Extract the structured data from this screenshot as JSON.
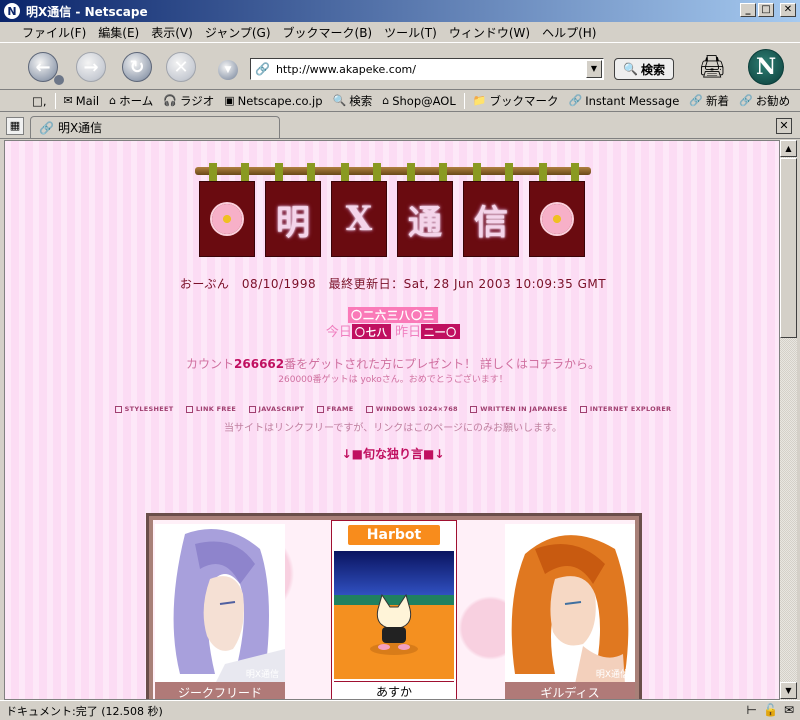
{
  "window": {
    "title": "明X通信 - Netscape",
    "icon": "netscape-n-icon"
  },
  "menu": [
    "ファイル(F)",
    "編集(E)",
    "表示(V)",
    "ジャンプ(G)",
    "ブックマーク(B)",
    "ツール(T)",
    "ウィンドウ(W)",
    "ヘルプ(H)"
  ],
  "toolbar": {
    "url": "http://www.akapeke.com/",
    "search_label": "検索"
  },
  "personal_bar": [
    {
      "label": "Mail",
      "icon": "mail-icon"
    },
    {
      "label": "ホーム",
      "icon": "home-icon"
    },
    {
      "label": "ラジオ",
      "icon": "headphones-icon"
    },
    {
      "label": "Netscape.co.jp",
      "icon": "my-icon"
    },
    {
      "label": "検索",
      "icon": "search-icon"
    },
    {
      "label": "Shop@AOL",
      "icon": "shop-icon"
    },
    {
      "label": "ブックマーク",
      "icon": "folder-icon"
    },
    {
      "label": "Instant Message",
      "icon": "link-icon"
    },
    {
      "label": "新着",
      "icon": "link-icon"
    },
    {
      "label": "お勧め",
      "icon": "link-icon"
    }
  ],
  "tab": {
    "label": "明X通信"
  },
  "page": {
    "banner_chars": [
      "明",
      "X",
      "通",
      "信"
    ],
    "since_line": "おーぷん　08/10/1998　最終更新日：Sat, 28 Jun 2003 10:09:35 GMT",
    "total_count": "〇二六三八〇三",
    "today_label": "今日",
    "today_count": "〇七八",
    "yesterday_label": "昨日",
    "yesterday_count": "二一〇",
    "kiriban_pre": "カウント",
    "kiriban_num": "266662",
    "kiriban_post": "番をゲットされた方にプレゼント！ 詳しくはコチラから。",
    "thanks": "260000番ゲットは yokoさん。おめでとうございます！",
    "env": [
      "STYLESHEET",
      "LINK FREE",
      "JAVASCRIPT",
      "FRAME",
      "WINDOWS 1024×768",
      "WRITTEN IN JAPANESE",
      "INTERNET EXPLORER"
    ],
    "linkfree": "当サイトはリンクフリーですが、リンクはこのページにのみお願いします。",
    "monologue": "↓■旬な独り言■↓",
    "characters": [
      {
        "name": "ジークフリード"
      },
      {
        "name": "あすか"
      },
      {
        "name": "ギルディス"
      }
    ],
    "harbot_logo": "Harbot",
    "art_watermark": "明X通信"
  },
  "status": {
    "text": "ドキュメント:完了 (12.508 秒)"
  },
  "colors": {
    "page_bg": "#fcdcf4",
    "noren": "#6a0b10",
    "accent": "#c01060"
  }
}
